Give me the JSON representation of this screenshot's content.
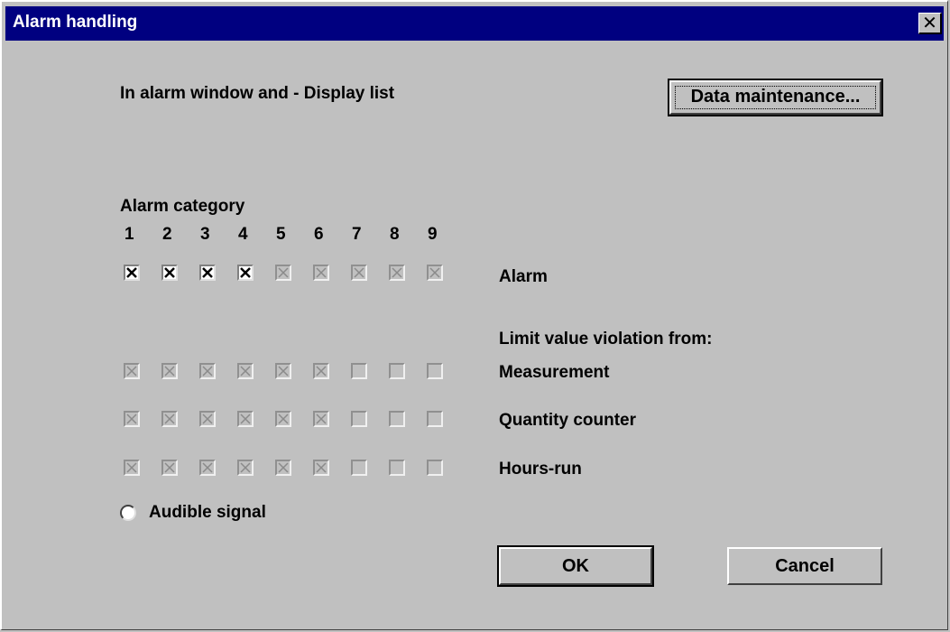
{
  "window": {
    "title": "Alarm handling",
    "close_label": "✕"
  },
  "header_text": "In alarm window and - Display list",
  "data_maintenance_label": "Data maintenance...",
  "alarm_category_label": "Alarm category",
  "category_numbers": [
    "1",
    "2",
    "3",
    "4",
    "5",
    "6",
    "7",
    "8",
    "9"
  ],
  "rows": [
    {
      "label": "Alarm",
      "states": [
        "checked",
        "checked",
        "checked",
        "checked",
        "checked-disabled",
        "checked-disabled",
        "checked-disabled",
        "checked-disabled",
        "checked-disabled"
      ]
    },
    {
      "label": "Measurement",
      "states": [
        "checked-disabled",
        "checked-disabled",
        "checked-disabled",
        "checked-disabled",
        "checked-disabled",
        "checked-disabled",
        "unchecked-disabled",
        "unchecked-disabled",
        "unchecked-disabled"
      ]
    },
    {
      "label": "Quantity counter",
      "states": [
        "checked-disabled",
        "checked-disabled",
        "checked-disabled",
        "checked-disabled",
        "checked-disabled",
        "checked-disabled",
        "unchecked-disabled",
        "unchecked-disabled",
        "unchecked-disabled"
      ]
    },
    {
      "label": "Hours-run",
      "states": [
        "checked-disabled",
        "checked-disabled",
        "checked-disabled",
        "checked-disabled",
        "checked-disabled",
        "checked-disabled",
        "unchecked-disabled",
        "unchecked-disabled",
        "unchecked-disabled"
      ]
    }
  ],
  "limit_value_label": "Limit value violation from:",
  "audible_signal_label": "Audible signal",
  "ok_label": "OK",
  "cancel_label": "Cancel"
}
